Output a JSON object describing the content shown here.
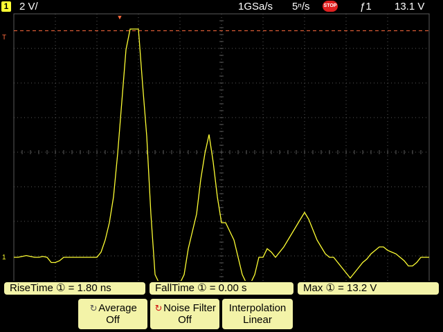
{
  "status_bar": {
    "channel_number": "1",
    "vertical_scale": "2 V/",
    "sample_rate": "1GSa/s",
    "timebase": "5ⁿ/s",
    "run_state": "STOP",
    "trigger_mode": "ƒ1",
    "trigger_level": "13.1 V"
  },
  "markers": {
    "trigger_level_marker": "T",
    "ground_marker": "1"
  },
  "measurements": {
    "rise_time": "RiseTime ① =  1.80 ns",
    "fall_time": "FallTime ① =  0.00  s",
    "max": "Max ① = 13.2  V"
  },
  "softkeys": {
    "average": {
      "label": "Average",
      "value": "Off"
    },
    "noise_filter": {
      "label": "Noise Filter",
      "value": "Off"
    },
    "interpolation": {
      "label": "Interpolation",
      "value": "Linear"
    }
  },
  "colors": {
    "trace": "#ffff33",
    "trigger_line": "#ff6a3d",
    "grid": "#5a5a5a",
    "softkey_bg": "#f3f3a8"
  },
  "chart_data": {
    "type": "line",
    "xlabel": "",
    "ylabel": "",
    "x_divisions": 10,
    "y_divisions": 8,
    "trigger_level_v": 13.1,
    "series": [
      {
        "x": [
          0,
          0.5,
          1,
          1.5,
          2,
          2.5,
          3,
          3.5,
          4,
          4.5,
          5,
          5.5,
          6,
          6.5,
          7,
          7.5,
          8,
          8.5,
          9,
          9.5,
          10,
          10.5,
          11,
          11.5,
          12,
          12.5,
          13,
          13.5,
          14,
          14.5,
          15,
          15.5,
          16,
          16.5,
          17,
          17.5,
          18,
          18.5,
          19,
          19.5,
          20,
          20.5,
          21,
          21.5,
          22,
          22.5,
          23,
          23.5,
          24,
          24.5,
          25,
          25.5,
          26,
          26.5,
          27,
          27.5,
          28,
          28.5,
          29,
          29.5,
          30,
          30.5,
          31,
          31.5,
          32,
          32.5,
          33,
          33.5,
          34,
          34.5,
          35,
          35.5,
          36,
          36.5,
          37,
          37.5,
          38,
          38.5,
          39,
          39.5,
          40,
          40.5,
          41,
          41.5,
          42,
          42.5,
          43,
          43.5,
          44,
          44.5,
          45,
          45.5,
          46,
          46.5,
          47,
          47.5,
          48,
          48.5,
          49,
          49.5,
          50
        ],
        "y": [
          0.0,
          0.0,
          0.05,
          0.1,
          0.05,
          0.0,
          0.0,
          0.05,
          0.0,
          -0.3,
          -0.3,
          -0.2,
          0.0,
          0.0,
          0.0,
          0.0,
          0.0,
          0.0,
          0.0,
          0.0,
          0.0,
          0.3,
          1.0,
          2.0,
          3.5,
          6.0,
          9.0,
          12.0,
          13.2,
          13.2,
          13.2,
          10.0,
          7.0,
          2.5,
          -1.0,
          -1.5,
          -1.5,
          -1.5,
          -1.5,
          -1.5,
          -1.5,
          -1.0,
          0.5,
          1.5,
          2.5,
          4.5,
          6.0,
          7.1,
          5.5,
          3.5,
          2.0,
          2.0,
          1.5,
          1.0,
          0.0,
          -1.0,
          -1.5,
          -1.5,
          -1.0,
          0.0,
          0.0,
          0.5,
          0.3,
          0.0,
          0.3,
          0.6,
          1.0,
          1.4,
          1.8,
          2.2,
          2.6,
          2.2,
          1.6,
          1.0,
          0.6,
          0.2,
          0.0,
          0.0,
          -0.3,
          -0.6,
          -0.9,
          -1.2,
          -0.9,
          -0.6,
          -0.3,
          -0.1,
          0.2,
          0.4,
          0.6,
          0.6,
          0.4,
          0.3,
          0.2,
          0.0,
          -0.2,
          -0.5,
          -0.5,
          -0.3,
          0.0,
          0.0,
          0.0
        ]
      }
    ],
    "xlim": [
      0,
      50
    ],
    "ylim": [
      -2,
      14
    ]
  }
}
